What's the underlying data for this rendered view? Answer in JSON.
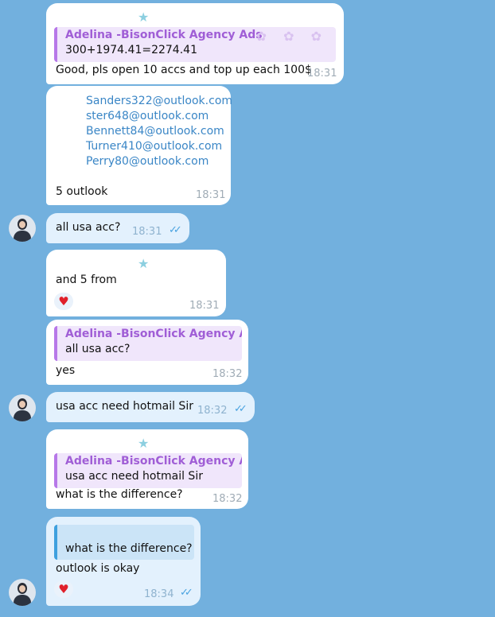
{
  "colors": {
    "background": "#72b0de",
    "incoming_bubble": "#ffffff",
    "outgoing_bubble": "#e3f1fd",
    "quote_accent": "#b778e8",
    "link": "#3a86c6"
  },
  "messages": [
    {
      "id": "m1",
      "quote_name": "Adelina -BisonClick Agency Ads",
      "quote_text": "300+1974.41=2274.41",
      "text": "Good, pls open 10 accs and top up each 100$",
      "time": "18:31",
      "icon": "star-icon"
    },
    {
      "id": "m2",
      "emails": [
        "Sanders322@outlook.com",
        "ster648@outlook.com",
        "Bennett84@outlook.com",
        "Turner410@outlook.com",
        "Perry80@outlook.com"
      ],
      "text": "5 outlook",
      "time": "18:31"
    },
    {
      "id": "m3",
      "text": "all usa acc?",
      "time": "18:31",
      "own": true
    },
    {
      "id": "m4",
      "text": "and 5 from",
      "time": "18:31",
      "icon": "star-icon",
      "reaction": "♥"
    },
    {
      "id": "m5",
      "quote_name": "Adelina -BisonClick Agency Ads",
      "quote_text": "all usa acc?",
      "text": "yes",
      "time": "18:32"
    },
    {
      "id": "m6",
      "text": "usa acc need hotmail Sir",
      "time": "18:32",
      "own": true
    },
    {
      "id": "m7",
      "quote_name": "Adelina -BisonClick Agency Ads",
      "quote_text": "usa acc need hotmail Sir",
      "text": "what is the difference?",
      "time": "18:32",
      "icon": "star-icon"
    },
    {
      "id": "m8",
      "quote_text": "what is the difference?",
      "text": "outlook is okay",
      "time": "18:34",
      "own": true,
      "reaction": "♥"
    }
  ],
  "icons": {
    "star": "★",
    "heart": "♥",
    "checks": "✓✓"
  }
}
